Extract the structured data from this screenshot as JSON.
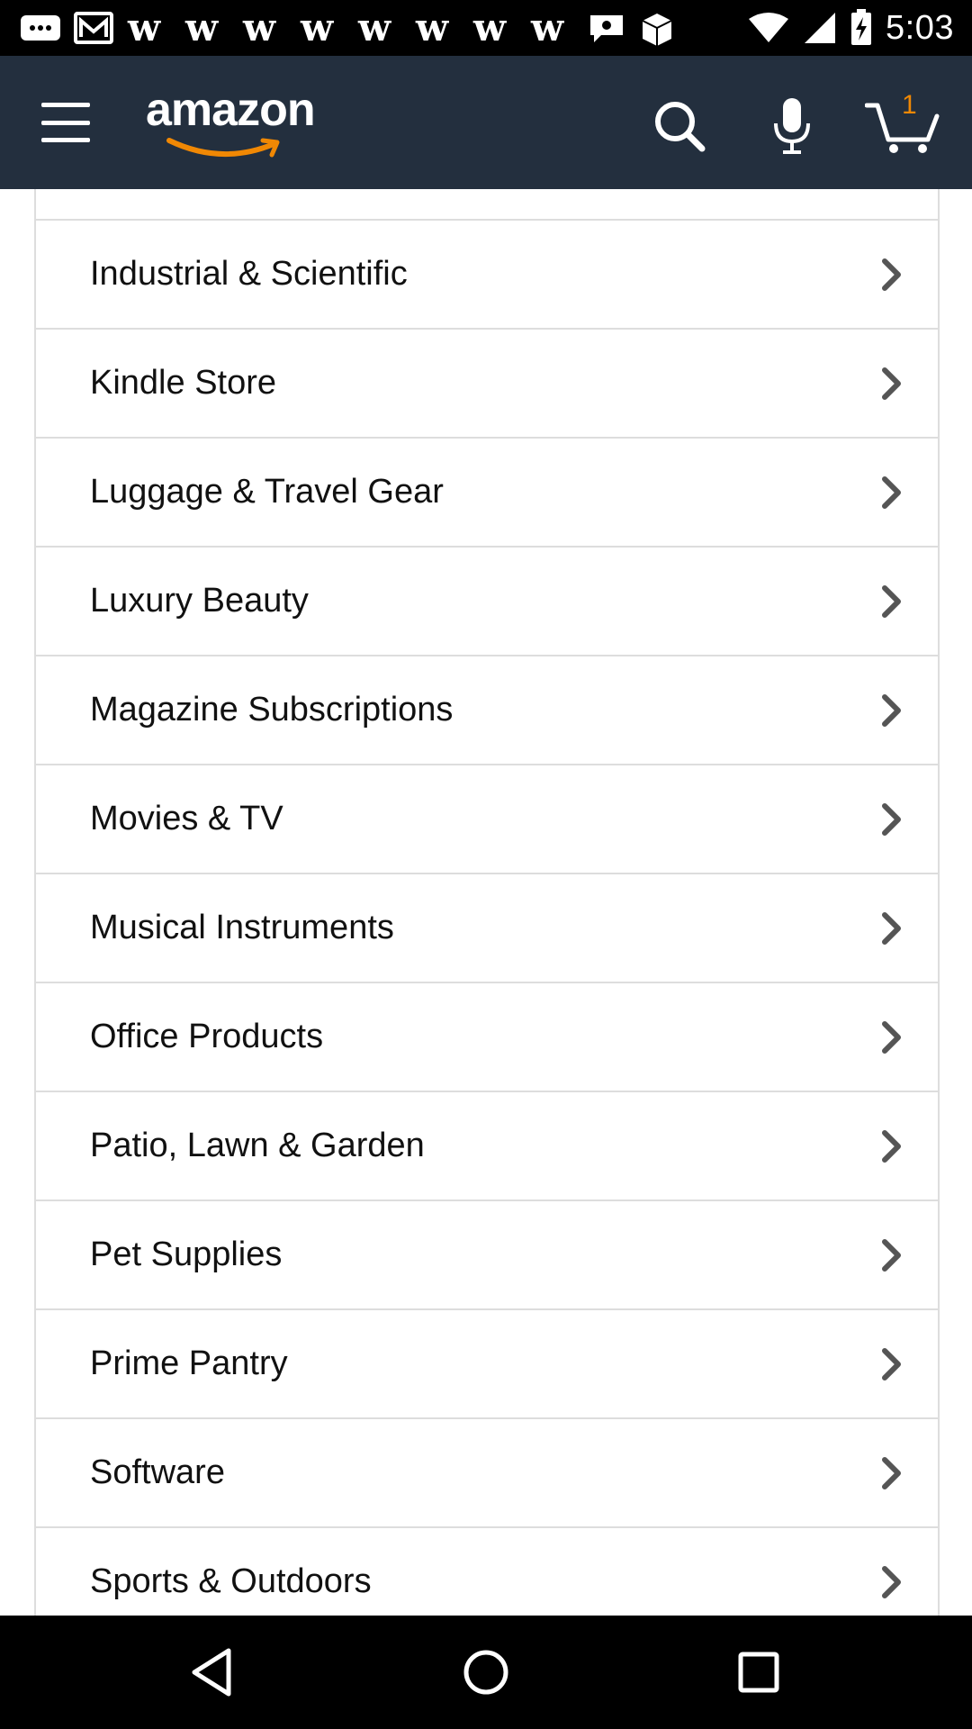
{
  "status_bar": {
    "time": "5:03",
    "notification_icons": [
      "notification-icon",
      "gmail-icon",
      "w-app-icon",
      "w-app-icon",
      "w-app-icon",
      "w-app-icon",
      "w-app-icon",
      "w-app-icon",
      "w-app-icon",
      "w-app-icon",
      "chat-bubble-icon",
      "package-icon"
    ],
    "system_icons": [
      "wifi-icon",
      "cell-signal-icon",
      "battery-charging-icon"
    ]
  },
  "header": {
    "logo_text": "amazon",
    "cart_count": "1",
    "background_color": "#232f3e",
    "accent_color": "#f08804"
  },
  "categories": [
    {
      "label": "Industrial & Scientific"
    },
    {
      "label": "Kindle Store"
    },
    {
      "label": "Luggage & Travel Gear"
    },
    {
      "label": "Luxury Beauty"
    },
    {
      "label": "Magazine Subscriptions"
    },
    {
      "label": "Movies & TV"
    },
    {
      "label": "Musical Instruments"
    },
    {
      "label": "Office Products"
    },
    {
      "label": "Patio, Lawn & Garden"
    },
    {
      "label": "Pet Supplies"
    },
    {
      "label": "Prime Pantry"
    },
    {
      "label": "Software"
    },
    {
      "label": "Sports & Outdoors"
    }
  ],
  "nav_bar": {
    "buttons": [
      "back-icon",
      "home-icon",
      "recents-icon"
    ]
  }
}
